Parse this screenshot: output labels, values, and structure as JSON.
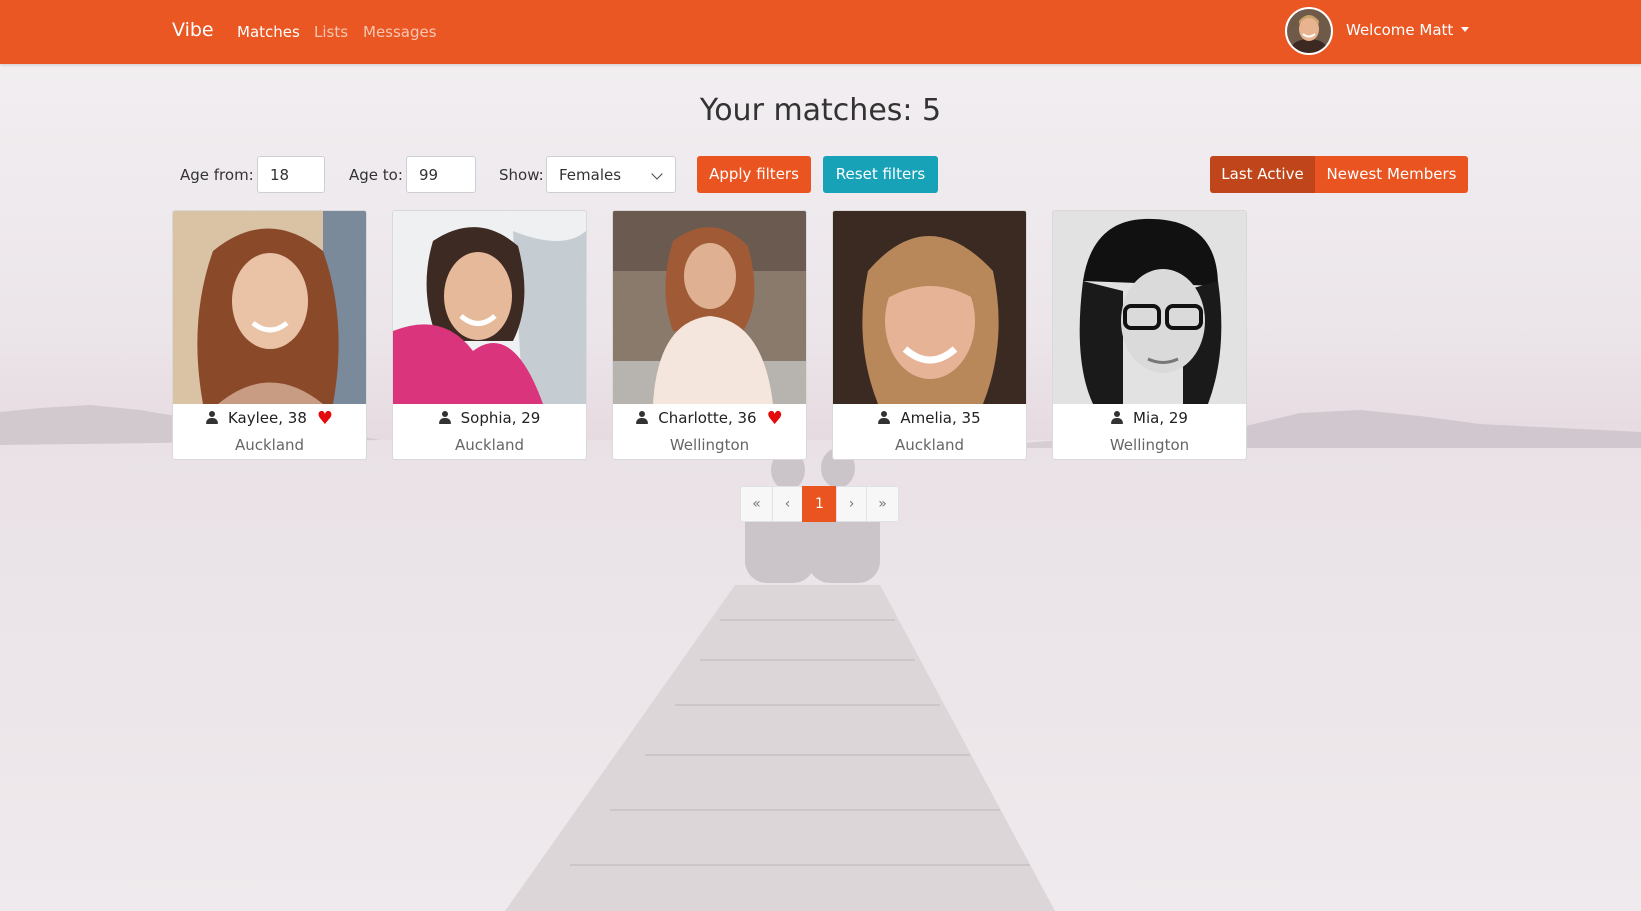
{
  "nav": {
    "brand": "Vibe",
    "links": [
      "Matches",
      "Lists",
      "Messages"
    ],
    "active_link": "Matches",
    "welcome": "Welcome Matt"
  },
  "title": "Your matches: 5",
  "filters": {
    "age_from_label": "Age from:",
    "age_from_value": "18",
    "age_to_label": "Age to:",
    "age_to_value": "99",
    "show_label": "Show:",
    "show_value": "Females",
    "apply_label": "Apply filters",
    "reset_label": "Reset filters"
  },
  "sort": {
    "last_active": "Last Active",
    "newest_members": "Newest Members",
    "selected": "Last Active"
  },
  "members": [
    {
      "name": "Kaylee, 38",
      "city": "Auckland",
      "liked": true
    },
    {
      "name": "Sophia, 29",
      "city": "Auckland",
      "liked": false
    },
    {
      "name": "Charlotte, 36",
      "city": "Wellington",
      "liked": true
    },
    {
      "name": "Amelia, 35",
      "city": "Auckland",
      "liked": false
    },
    {
      "name": "Mia, 29",
      "city": "Wellington",
      "liked": false
    }
  ],
  "pagination": {
    "first": "«",
    "prev": "‹",
    "current": "1",
    "next": "›",
    "last": "»"
  },
  "colors": {
    "primary": "#e95420",
    "info": "#17a2b8",
    "like": "#e30b0b"
  }
}
